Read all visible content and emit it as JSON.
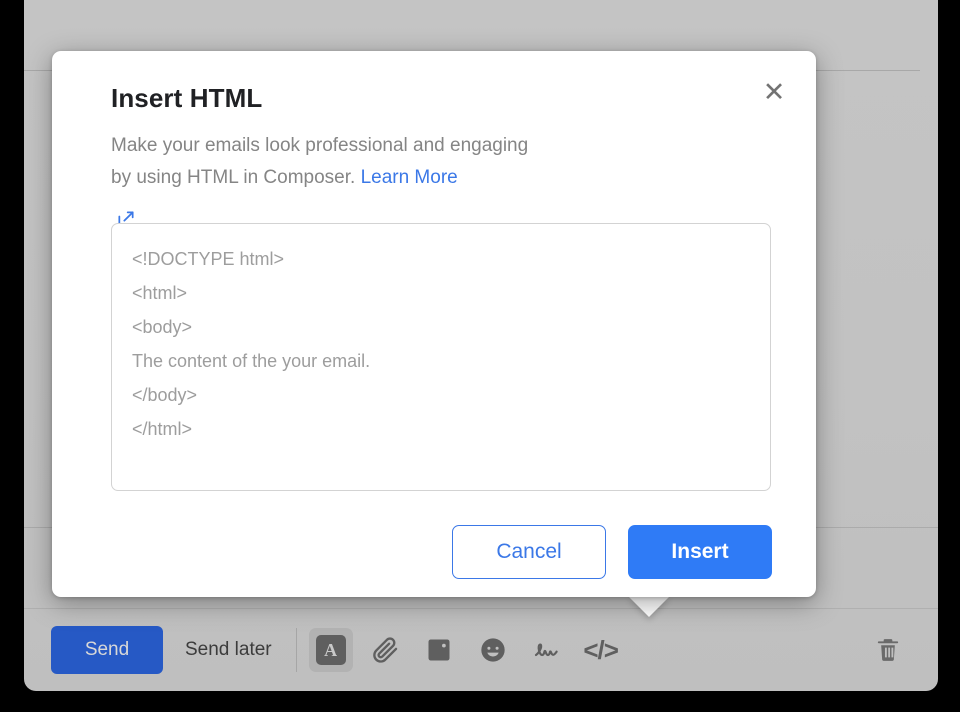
{
  "dialog": {
    "title": "Insert HTML",
    "description_line1": "Make your emails look professional and engaging",
    "description_line2": "by using HTML in Composer. ",
    "learn_more_label": "Learn More",
    "close_label": "✕",
    "popout_icon": "open-in-new-icon",
    "code_placeholder": "<!DOCTYPE html>\n<html>\n<body>\nThe content of the your email.\n</body>\n</html>",
    "cancel_label": "Cancel",
    "insert_label": "Insert",
    "accent_color": "#3b78e7",
    "primary_button_color": "#2f7bf6"
  },
  "toolbar": {
    "send_label": "Send",
    "send_later_label": "Send later",
    "send_button_color": "#2659c5",
    "icons": [
      {
        "name": "format-text-icon",
        "glyph": "A",
        "active": true
      },
      {
        "name": "attachment-icon",
        "glyph": "",
        "active": false
      },
      {
        "name": "insert-image-icon",
        "glyph": "",
        "active": false
      },
      {
        "name": "emoji-icon",
        "glyph": "",
        "active": false
      },
      {
        "name": "signature-icon",
        "glyph": "",
        "active": false
      },
      {
        "name": "insert-html-code-icon",
        "glyph": "</>",
        "active": true
      }
    ],
    "delete_icon": "trash-icon"
  }
}
